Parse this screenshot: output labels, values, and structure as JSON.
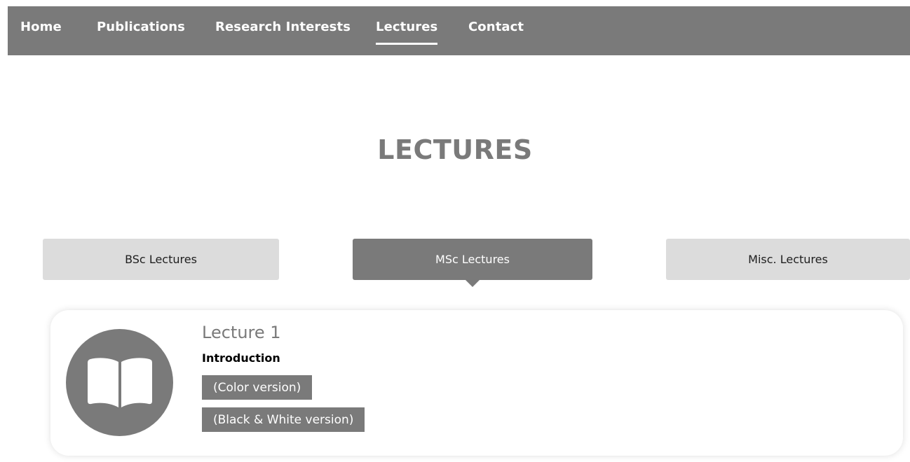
{
  "nav": {
    "items": [
      {
        "label": "Home"
      },
      {
        "label": "Publications"
      },
      {
        "label": "Research Interests"
      },
      {
        "label": "Lectures"
      },
      {
        "label": "Contact"
      }
    ],
    "active": "Lectures"
  },
  "page": {
    "title": "LECTURES"
  },
  "tabs": [
    {
      "label": "BSc Lectures"
    },
    {
      "label": "MSc Lectures"
    },
    {
      "label": "Misc. Lectures"
    }
  ],
  "active_tab": "MSc Lectures",
  "lecture": {
    "title": "Lecture 1",
    "subtitle": "Introduction",
    "icon": "open-book-icon",
    "buttons": [
      {
        "label": "(Color version)"
      },
      {
        "label": "(Black & White version)"
      }
    ]
  },
  "colors": {
    "primary": "#7a7a7a",
    "inactive_tab": "#dcdcdc",
    "text_dark": "#1e1e1e"
  }
}
